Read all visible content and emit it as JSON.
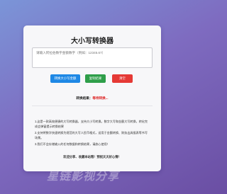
{
  "app": {
    "title": "大小写转换器"
  },
  "input": {
    "placeholder": "请输入阿拉伯数字金额数字（例如：12345.67）",
    "value": ""
  },
  "buttons": {
    "convert_label": "转换大小写金额",
    "copy_label": "复制结果",
    "clear_label": "清空"
  },
  "result": {
    "label": "转换结果：",
    "value": "等待转换..."
  },
  "info": {
    "items": [
      "1.这是一款高效便捷的大写转换器，支持大小写转换。数字大写和金额大写转换，转化完成会弹窗提示转换结果",
      "2.支持将数字快速转换为规范的大写人民币格式，适用于金额转换、财务出具报表等书写场景。",
      "3.我们不会存储输入的任何数据和转换结果，请放心使用！"
    ],
    "footer": "欢迎分享、收藏本站哦！预祝天天好心情！"
  },
  "watermark": {
    "text": "星链影视分享"
  },
  "colors": {
    "convert": "#1e88e5",
    "copy": "#2e9e49",
    "clear": "#e53935",
    "result_value": "#dd2222"
  }
}
